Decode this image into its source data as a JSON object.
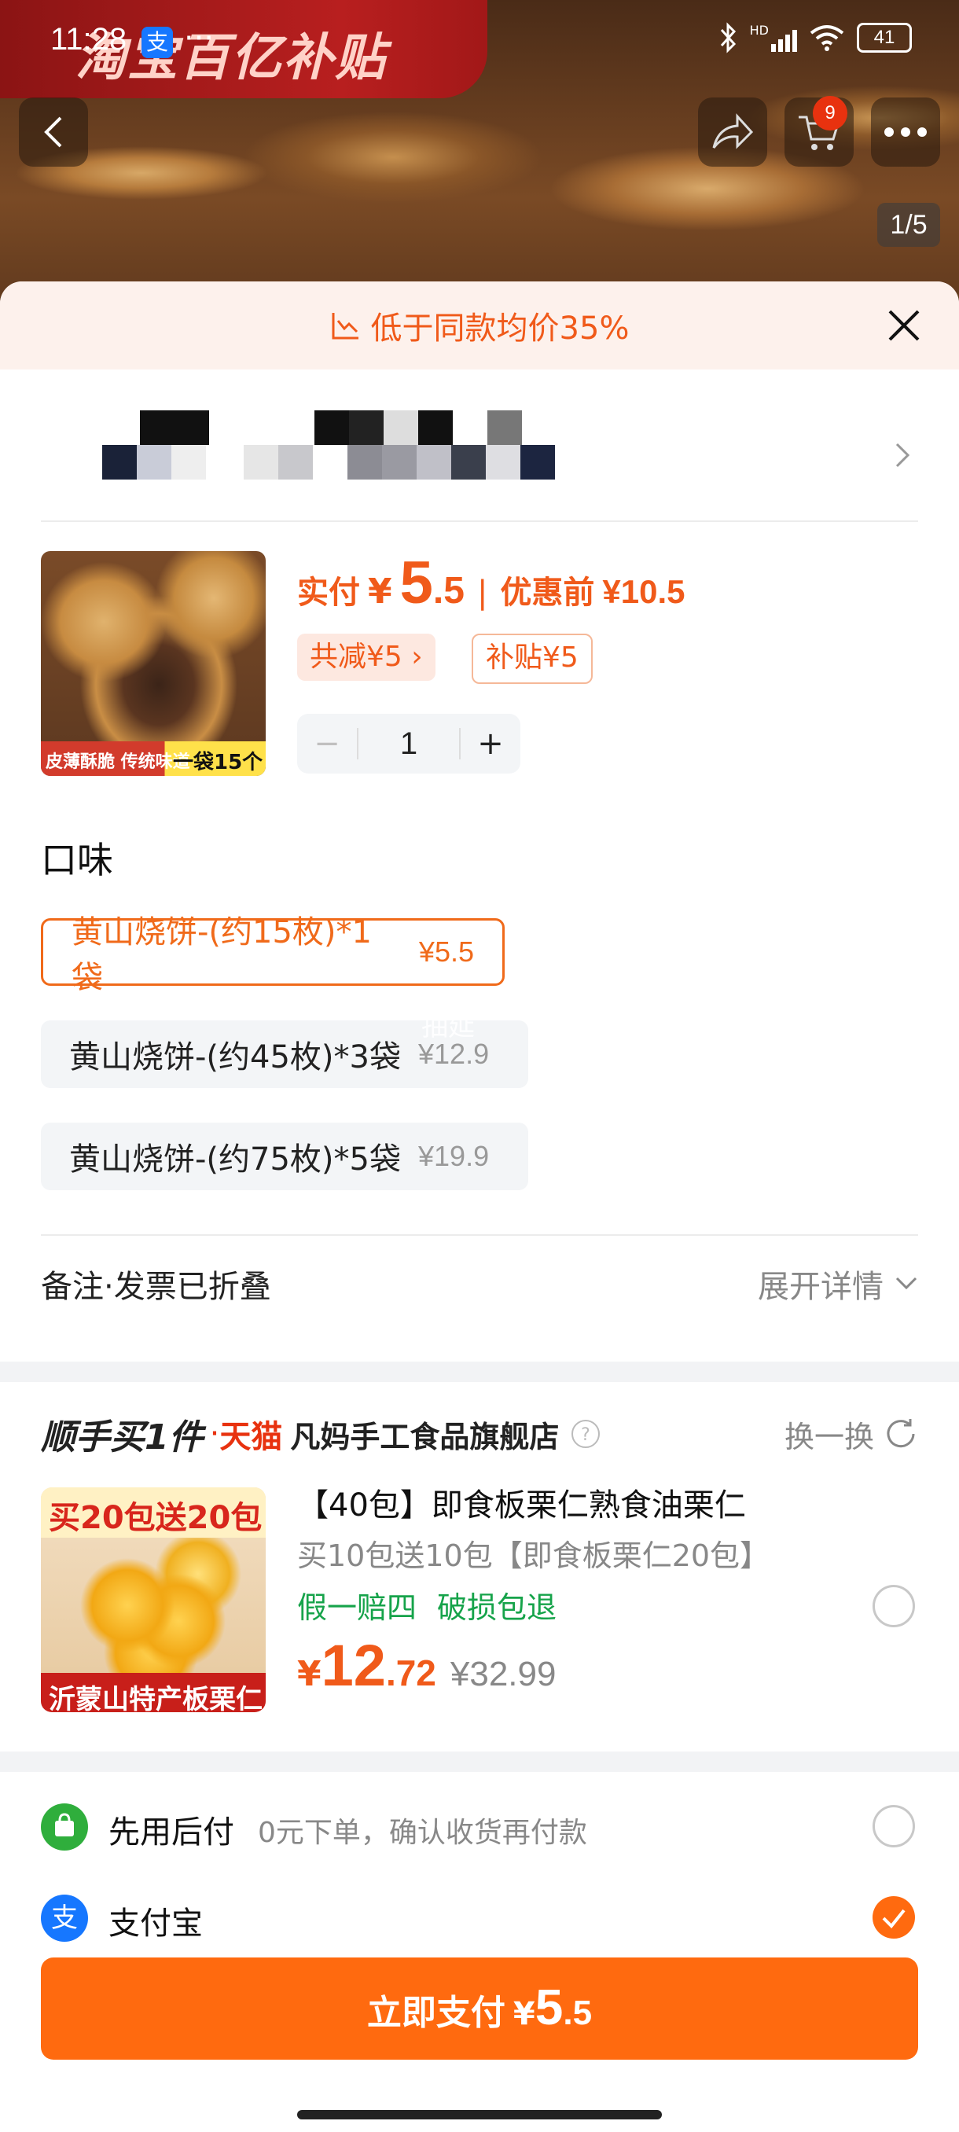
{
  "status_bar": {
    "time": "11:28",
    "dots": "···",
    "network": "HD",
    "battery": "41"
  },
  "promo": {
    "banner_text": "淘宝百亿补贴"
  },
  "gallery": {
    "page_indicator": "1/5",
    "cart_count": "9"
  },
  "price_banner": {
    "text": "低于同款均价35%"
  },
  "product": {
    "pay_label": "实付",
    "pay_currency": "¥",
    "pay_int": "5",
    "pay_dec": ".5",
    "before_label": "优惠前",
    "before_price": "¥10.5",
    "tag_reduce": "共减¥5",
    "tag_subsidy": "补贴¥5",
    "quantity": "1",
    "img_left_text": "皮薄酥脆 传统味道",
    "img_right_text": "一袋15个"
  },
  "flavor": {
    "title": "口味",
    "options": [
      {
        "label": "黄山烧饼-(约15枚)*1袋",
        "price": "¥5.5"
      },
      {
        "label": "黄山烧饼-(约45枚)*3袋",
        "price": "¥12.9"
      },
      {
        "label": "黄山烧饼-(约75枚)*5袋",
        "price": "¥19.9"
      }
    ],
    "watermark": "抽延"
  },
  "remark": {
    "label": "备注·发票已折叠",
    "expand": "展开详情"
  },
  "addon": {
    "title": "顺手买1件",
    "tmall": "天猫",
    "store": "凡妈手工食品旗舰店",
    "swap": "换一换",
    "name": "【40包】即食板栗仁熟食油栗仁",
    "sub": "买10包送10包【即食板栗仁20包】",
    "guarantee1": "假一赔四",
    "guarantee2": "破损包退",
    "currency": "¥",
    "price_int": "12",
    "price_dec": ".72",
    "orig_price": "¥32.99",
    "img_top": "买20包送20包",
    "img_bottom": "沂蒙山特产板栗仁"
  },
  "payment": {
    "paylater_title": "先用后付",
    "paylater_desc": "0元下单，确认收货再付款",
    "alipay_title": "支付宝"
  },
  "pay_button": {
    "label": "立即支付",
    "currency": "¥",
    "int": "5",
    "dec": ".5"
  },
  "colors": {
    "accent": "#ff6a0f",
    "accent_text": "#f05a1a",
    "green": "#16a34a"
  }
}
